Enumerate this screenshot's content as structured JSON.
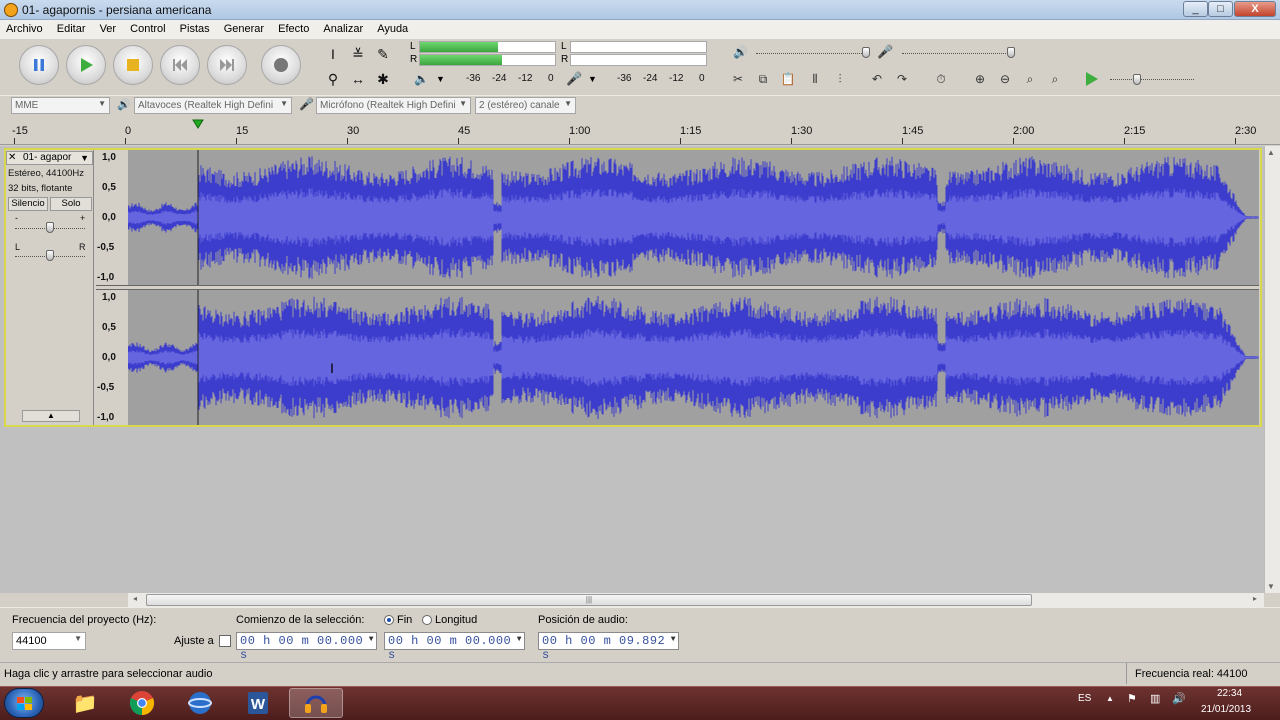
{
  "window": {
    "title": "01- agapornis - persiana americana",
    "controls": [
      "_",
      "□",
      "X"
    ]
  },
  "menu": [
    "Archivo",
    "Editar",
    "Ver",
    "Control",
    "Pistas",
    "Generar",
    "Efecto",
    "Analizar",
    "Ayuda"
  ],
  "transport": {
    "buttons": [
      "pause-icon",
      "play-icon",
      "stop-icon",
      "skip-start-icon",
      "skip-end-icon",
      "record-icon"
    ]
  },
  "meters": {
    "left_letter": "L",
    "right_letter": "R",
    "left_level": 0.58,
    "right_level": 0.61,
    "scale": [
      "-36",
      "-24",
      "-12",
      "0"
    ],
    "rec_scale": [
      "-36",
      "-24",
      "-12",
      "0"
    ]
  },
  "devices": {
    "host": "MME",
    "output": "Altavoces (Realtek High Defini",
    "input": "Micrófono (Realtek High Defini",
    "channels": "2 (estéreo) canale"
  },
  "ruler": {
    "labels": [
      "-15",
      "0",
      "15",
      "30",
      "45",
      "1:00",
      "1:15",
      "1:30",
      "1:45",
      "2:00",
      "2:15",
      "2:30"
    ]
  },
  "track": {
    "name": "01- agapor",
    "info1": "Estéreo, 44100Hz",
    "info2": "32 bits, flotante",
    "mute": "Silencio",
    "solo": "Solo",
    "gain_minus": "-",
    "gain_plus": "+",
    "pan_left": "L",
    "pan_right": "R",
    "scale": [
      "1,0",
      "0,5",
      "0,0",
      "-0,5",
      "-1,0"
    ]
  },
  "selection": {
    "rate_label": "Frecuencia del proyecto (Hz):",
    "rate_value": "44100",
    "snap_label": "Ajuste a",
    "start_label": "Comienzo de la selección:",
    "end_option": "Fin",
    "length_option": "Longitud",
    "position_label": "Posición de audio:",
    "start_time": "00 h 00 m 00.000 s",
    "end_time": "00 h 00 m 00.000 s",
    "audio_position": "00 h 00 m 09.892 s"
  },
  "status": {
    "left": "Haga clic y arrastre para seleccionar audio",
    "right": "Frecuencia real: 44100"
  },
  "taskbar": {
    "lang": "ES",
    "time": "22:34",
    "date": "21/01/2013"
  },
  "colors": {
    "waveform": "#3c3ccd",
    "waveform_rms": "#6565e0",
    "track_bg": "#a0a0a0",
    "selection_border": "#d8d84a"
  }
}
